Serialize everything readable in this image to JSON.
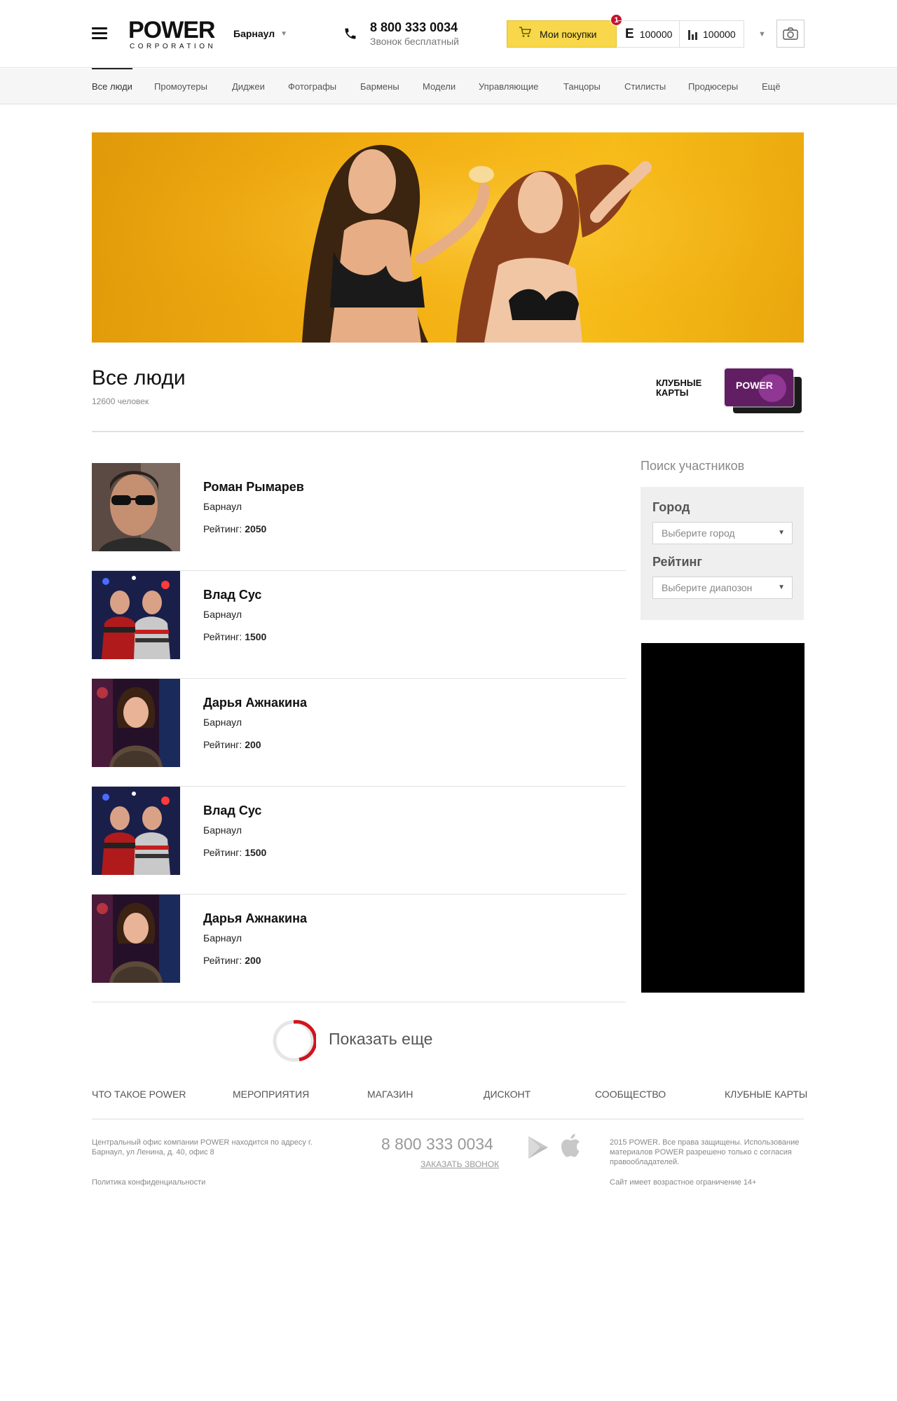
{
  "header": {
    "logo_main": "POWER",
    "logo_sub": "CORPORATION",
    "city": "Барнаул",
    "phone": "8 800 333 0034",
    "phone_note": "Звонок бесплатный",
    "purchases_label": "Мои покупки",
    "purchases_badge": "1",
    "points_icon": "E",
    "points_value": "100000",
    "rating_value": "100000",
    "icons": [
      "menu-icon",
      "phone-icon",
      "cart-icon",
      "points-icon",
      "bar-chart-icon",
      "chevron-down-icon",
      "camera-icon"
    ]
  },
  "nav": {
    "items": [
      "Все люди",
      "Промоутеры",
      "Диджеи",
      "Фотографы",
      "Бармены",
      "Модели",
      "Управляющие",
      "Танцоры",
      "Стилисты",
      "Продюсеры",
      "Ещё"
    ],
    "active": "Все люди"
  },
  "page": {
    "title": "Все люди",
    "count": "12600 человек",
    "club_cards_label": "КЛУБНЫЕ КАРТЫ",
    "card_logo": "POWER"
  },
  "people": [
    {
      "name": "Роман Рымарев",
      "city": "Барнаул",
      "rating_label": "Рейтинг:",
      "rating": "2050"
    },
    {
      "name": "Влад Сус",
      "city": "Барнаул",
      "rating_label": "Рейтинг:",
      "rating": "1500"
    },
    {
      "name": "Дарья Ажнакина",
      "city": "Барнаул",
      "rating_label": "Рейтинг:",
      "rating": "200"
    },
    {
      "name": "Влад Сус",
      "city": "Барнаул",
      "rating_label": "Рейтинг:",
      "rating": "1500"
    },
    {
      "name": "Дарья Ажнакина",
      "city": "Барнаул",
      "rating_label": "Рейтинг:",
      "rating": "200"
    }
  ],
  "sidebar": {
    "search_title": "Поиск участников",
    "city_label": "Город",
    "city_placeholder": "Выберите город",
    "rating_label": "Рейтинг",
    "rating_placeholder": "Выберите диапозон"
  },
  "show_more": "Показать еще",
  "footer": {
    "nav": [
      "ЧТО ТАКОЕ POWER",
      "МЕРОПРИЯТИЯ",
      "МАГАЗИН",
      "ДИСКОНТ",
      "СООБЩЕСТВО",
      "КЛУБНЫЕ КАРТЫ"
    ],
    "address": "Центральный офис компании POWER находится по адресу г. Барнаул, ул Ленина, д. 40, офис 8",
    "policy": "Политика конфиденциальности",
    "phone": "8 800 333 0034",
    "callback": "ЗАКАЗАТЬ ЗВОНОК",
    "copyright": "2015 POWER. Все права защищены. Использование материалов POWER разрешено только с согласия правообладателей.",
    "age": "Сайт имеет возрастное ограничение 14+"
  },
  "colors": {
    "accent_red": "#c8102e",
    "purchases_yellow": "#f8d84a",
    "hero_orange": "#f2ad12",
    "nav_bg": "#f6f6f6"
  }
}
